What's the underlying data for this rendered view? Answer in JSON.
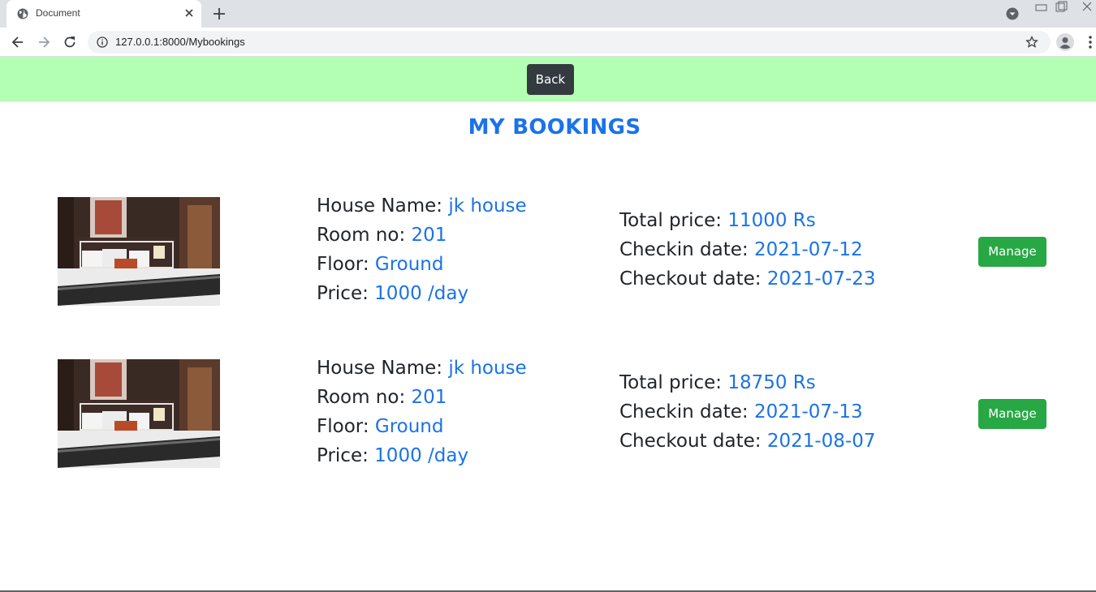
{
  "browser": {
    "tab_title": "Document",
    "url": "127.0.0.1:8000/Mybookings"
  },
  "page": {
    "back_label": "Back",
    "title": "MY BOOKINGS",
    "labels": {
      "house_name": "House Name: ",
      "room_no": "Room no: ",
      "floor": "Floor: ",
      "price": "Price: ",
      "total_price": "Total price: ",
      "checkin": "Checkin date: ",
      "checkout": "Checkout date: "
    },
    "manage_label": "Manage",
    "colors": {
      "topbar_bg": "#b3ffb3",
      "accent": "#1a73e8",
      "manage_btn": "#28a745",
      "back_btn": "#343a40"
    }
  },
  "bookings": [
    {
      "house_name": "jk house",
      "room_no": "201",
      "floor": "Ground",
      "price": "1000 /day",
      "total_price": "11000 Rs",
      "checkin": "2021-07-12",
      "checkout": "2021-07-23"
    },
    {
      "house_name": "jk house",
      "room_no": "201",
      "floor": "Ground",
      "price": "1000 /day",
      "total_price": "18750 Rs",
      "checkin": "2021-07-13",
      "checkout": "2021-08-07"
    }
  ]
}
